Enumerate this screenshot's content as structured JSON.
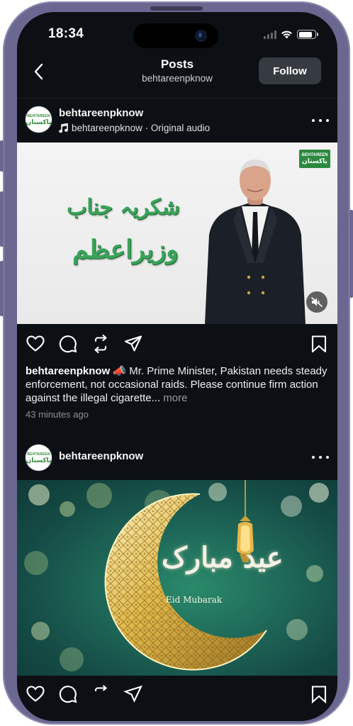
{
  "status_bar": {
    "time": "18:34",
    "battery_level": 0.85
  },
  "header": {
    "title": "Posts",
    "subtitle": "behtareenpknow",
    "follow_label": "Follow"
  },
  "posts": [
    {
      "username": "behtareenpknow",
      "avatar_text_top": "BEHTAREEN",
      "avatar_text_main": "پاکستان",
      "audio_label": "behtareenpknow · Original audio",
      "media": {
        "urdu_line1": "شکریہ جناب",
        "urdu_line2": "وزیراعظم",
        "brand_top": "BEHTAREEN",
        "brand_main": "پاکستان",
        "muted": true
      },
      "caption_user": "behtareenpknow",
      "caption_emoji": "📣",
      "caption_text": "Mr. Prime Minister, Pakistan needs steady enforcement, not occasional raids. Please continue firm action against the illegal cigarette...",
      "caption_more": "more",
      "timestamp": "43 minutes ago"
    },
    {
      "username": "behtareenpknow",
      "avatar_text_top": "BEHTAREEN",
      "avatar_text_main": "پاکستان",
      "media": {
        "calligraphy": "عید مبارک",
        "subtitle": "Eid Mubarak"
      }
    }
  ],
  "icons": {
    "back": "chevron-left-icon",
    "audio": "music-note-icon",
    "more": "ellipsis-icon",
    "like": "heart-icon",
    "comment": "comment-icon",
    "repost": "repost-icon",
    "share": "send-icon",
    "save": "bookmark-icon",
    "mute": "speaker-muted-icon"
  },
  "colors": {
    "background": "#0c1014",
    "follow_button": "#363a41",
    "urdu_green": "#3aa35a",
    "eid_green": "#1f6a5a",
    "gold": "#e0b84a"
  }
}
